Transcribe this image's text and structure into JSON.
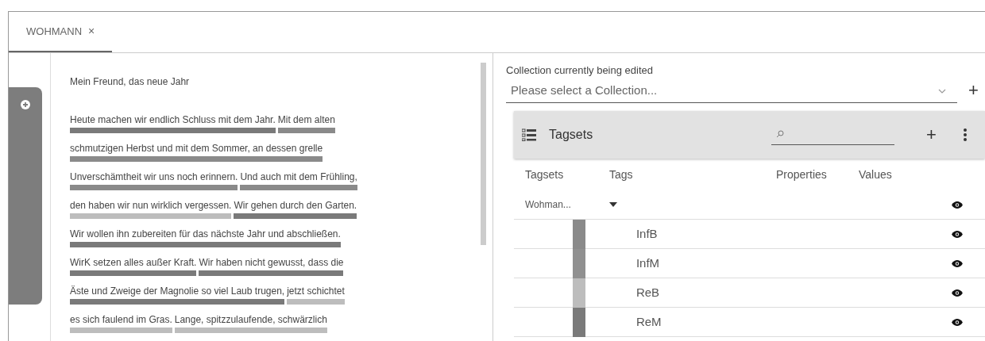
{
  "tabs": [
    {
      "label": "WOHMANN",
      "close": "×",
      "selected": true
    }
  ],
  "document": {
    "title": "Mein Freund, das neue Jahr",
    "lines": [
      {
        "segments": [
          {
            "text": "Heute machen wir endlich Schluss mit dem Jahr.",
            "color": "#7a7a7a"
          },
          {
            "text": " Mit dem alten",
            "color": "#8a8a8a"
          }
        ]
      },
      {
        "segments": [
          {
            "text": "schmutzigen Herbst und mit dem Sommer, an dessen grelle",
            "color": "#8a8a8a"
          }
        ]
      },
      {
        "segments": [
          {
            "text": "Unverschämtheit wir uns noch erinnern.",
            "color": "#8a8a8a"
          },
          {
            "text": " Und auch mit dem Frühling,",
            "color": "#8a8a8a"
          }
        ]
      },
      {
        "segments": [
          {
            "text": "den haben wir nun wirklich vergessen.",
            "color": "#bdbdbd"
          },
          {
            "text": " Wir gehen durch den Garten.",
            "color": "#7a7a7a"
          }
        ]
      },
      {
        "segments": [
          {
            "text": "Wir wollen ihn zubereiten für das nächste Jahr und abschließen.",
            "color": "#7a7a7a"
          }
        ]
      },
      {
        "segments": [
          {
            "text": "WirK setzen alles außer Kraft.",
            "color": "#7a7a7a"
          },
          {
            "text": " Wir haben nicht gewusst, dass die",
            "color": "#7a7a7a"
          }
        ]
      },
      {
        "segments": [
          {
            "text": "Äste und Zweige der Magnolie so viel Laub trugen,",
            "color": "#7a7a7a"
          },
          {
            "text": " jetzt schichtet",
            "color": "#bdbdbd"
          }
        ]
      },
      {
        "segments": [
          {
            "text": "es sich faulend im Gras.",
            "color": "#bdbdbd"
          },
          {
            "text": " Lange, spitzzulaufende, schwärzlich",
            "color": "#bdbdbd"
          }
        ]
      }
    ]
  },
  "collection": {
    "label": "Collection currently being edited",
    "placeholder": "Please select a Collection...",
    "add": "+"
  },
  "tagsets_panel": {
    "title": "Tagsets",
    "add": "+",
    "columns": [
      "Tagsets",
      "Tags",
      "Properties",
      "Values"
    ],
    "tagsets": [
      {
        "name": "Wohman...",
        "expanded": true,
        "children": [
          {
            "name": "InfB",
            "color": "#8a8a8a"
          },
          {
            "name": "InfM",
            "color": "#909090"
          },
          {
            "name": "ReB",
            "color": "#bdbdbd"
          },
          {
            "name": "ReM",
            "color": "#7a7a7a"
          }
        ]
      }
    ]
  }
}
